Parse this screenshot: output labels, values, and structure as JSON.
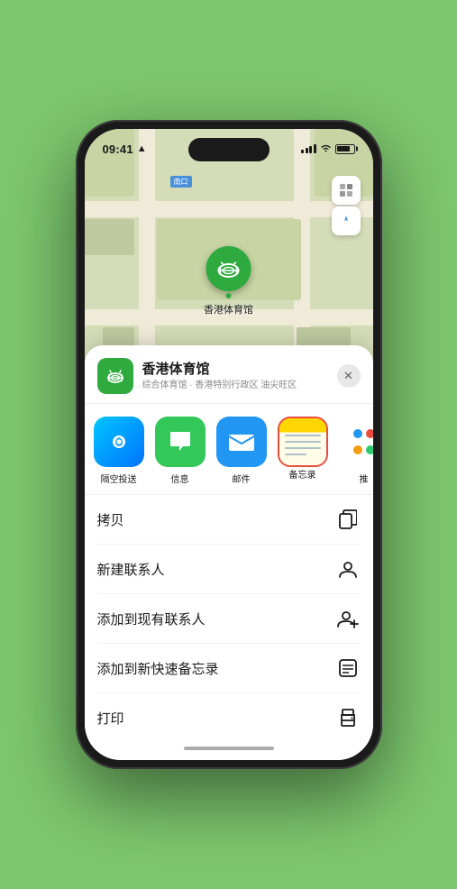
{
  "status_bar": {
    "time": "09:41",
    "location_arrow": "▶"
  },
  "map": {
    "label_text": "南口",
    "controls": {
      "map_icon": "🗺",
      "location_icon": "➤"
    },
    "pin": {
      "label": "香港体育馆",
      "emoji": "🏟"
    }
  },
  "venue_card": {
    "name": "香港体育馆",
    "subtitle": "综合体育馆 · 香港特别行政区 油尖旺区",
    "close_label": "✕"
  },
  "share_items": [
    {
      "id": "airdrop",
      "label": "隔空投送",
      "type": "airdrop"
    },
    {
      "id": "messages",
      "label": "信息",
      "type": "messages"
    },
    {
      "id": "mail",
      "label": "邮件",
      "type": "mail"
    },
    {
      "id": "notes",
      "label": "备忘录",
      "type": "notes"
    },
    {
      "id": "more",
      "label": "推",
      "type": "more"
    }
  ],
  "actions": [
    {
      "label": "拷贝",
      "icon": "copy"
    },
    {
      "label": "新建联系人",
      "icon": "person"
    },
    {
      "label": "添加到现有联系人",
      "icon": "person-add"
    },
    {
      "label": "添加到新快速备忘录",
      "icon": "note"
    },
    {
      "label": "打印",
      "icon": "print"
    }
  ]
}
